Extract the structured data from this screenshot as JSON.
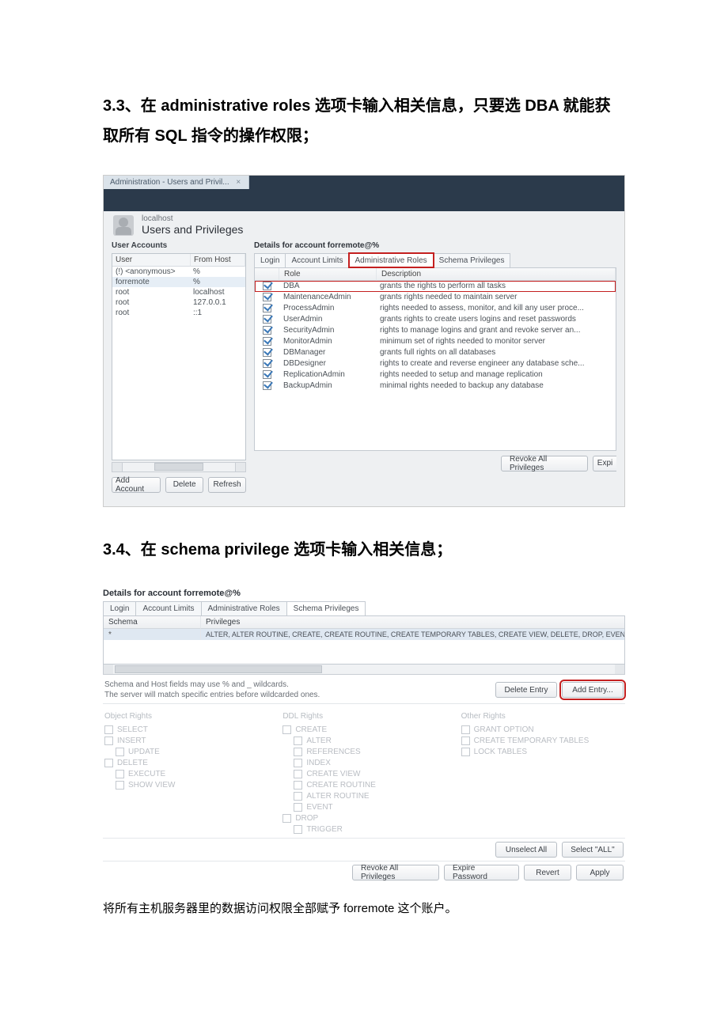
{
  "heading1": "3.3、在 administrative roles 选项卡输入相关信息，只要选 DBA 就能获取所有 SQL 指令的操作权限；",
  "heading2": "3.4、在 schema privilege 选项卡输入相关信息；",
  "caption2": "将所有主机服务器里的数据访问权限全部赋予 forremote 这个账户。",
  "shot1": {
    "doc_tab": "Administration - Users and Privil...",
    "host_small": "localhost",
    "page_title": "Users and Privileges",
    "section_left": "User Accounts",
    "user_head_user": "User",
    "user_head_host": "From Host",
    "users": [
      {
        "user": "(!) <anonymous>",
        "host": "%"
      },
      {
        "user": "forremote",
        "host": "%"
      },
      {
        "user": "root",
        "host": "localhost"
      },
      {
        "user": "root",
        "host": "127.0.0.1"
      },
      {
        "user": "root",
        "host": "::1"
      }
    ],
    "btn_add": "Add Account",
    "btn_del": "Delete",
    "btn_ref": "Refresh",
    "details_title": "Details for account forremote@%",
    "tabs": {
      "login": "Login",
      "limits": "Account Limits",
      "roles": "Administrative Roles",
      "schema": "Schema Privileges"
    },
    "roles_head_role": "Role",
    "roles_head_desc": "Description",
    "roles": [
      {
        "role": "DBA",
        "desc": "grants the rights to perform all tasks"
      },
      {
        "role": "MaintenanceAdmin",
        "desc": "grants rights needed to maintain server"
      },
      {
        "role": "ProcessAdmin",
        "desc": "rights needed to assess, monitor, and kill any user proce..."
      },
      {
        "role": "UserAdmin",
        "desc": "grants rights to create users logins and reset passwords"
      },
      {
        "role": "SecurityAdmin",
        "desc": "rights to manage logins and grant and revoke server an..."
      },
      {
        "role": "MonitorAdmin",
        "desc": "minimum set of rights needed to monitor server"
      },
      {
        "role": "DBManager",
        "desc": "grants full rights on all databases"
      },
      {
        "role": "DBDesigner",
        "desc": "rights to create and reverse engineer any database sche..."
      },
      {
        "role": "ReplicationAdmin",
        "desc": "rights needed to setup and manage replication"
      },
      {
        "role": "BackupAdmin",
        "desc": "minimal rights needed to backup any database"
      }
    ],
    "btn_revoke": "Revoke All Privileges",
    "btn_expire": "Expi"
  },
  "shot2": {
    "details_title": "Details for account forremote@%",
    "tabs": {
      "login": "Login",
      "limits": "Account Limits",
      "roles": "Administrative Roles",
      "schema": "Schema Privileges"
    },
    "head_schema": "Schema",
    "head_priv": "Privileges",
    "row_schema": "*",
    "row_priv": "ALTER, ALTER ROUTINE, CREATE, CREATE ROUTINE, CREATE TEMPORARY TABLES, CREATE VIEW, DELETE, DROP, EVENT, EXECUTE,",
    "hint": "Schema and Host fields may use % and _ wildcards.\nThe server will match specific entries before wildcarded ones.",
    "btn_delentry": "Delete Entry",
    "btn_addentry": "Add Entry...",
    "obj_title": "Object Rights",
    "obj": [
      "SELECT",
      "INSERT",
      "UPDATE",
      "DELETE",
      "EXECUTE",
      "SHOW VIEW"
    ],
    "ddl_title": "DDL Rights",
    "ddl": [
      "CREATE",
      "ALTER",
      "REFERENCES",
      "INDEX",
      "CREATE VIEW",
      "CREATE ROUTINE",
      "ALTER ROUTINE",
      "EVENT",
      "DROP",
      "TRIGGER"
    ],
    "other_title": "Other Rights",
    "other": [
      "GRANT OPTION",
      "CREATE TEMPORARY TABLES",
      "LOCK TABLES"
    ],
    "btn_unselect": "Unselect All",
    "btn_selectall": "Select \"ALL\"",
    "btn_revoke": "Revoke All Privileges",
    "btn_expire": "Expire Password",
    "btn_revert": "Revert",
    "btn_apply": "Apply"
  }
}
